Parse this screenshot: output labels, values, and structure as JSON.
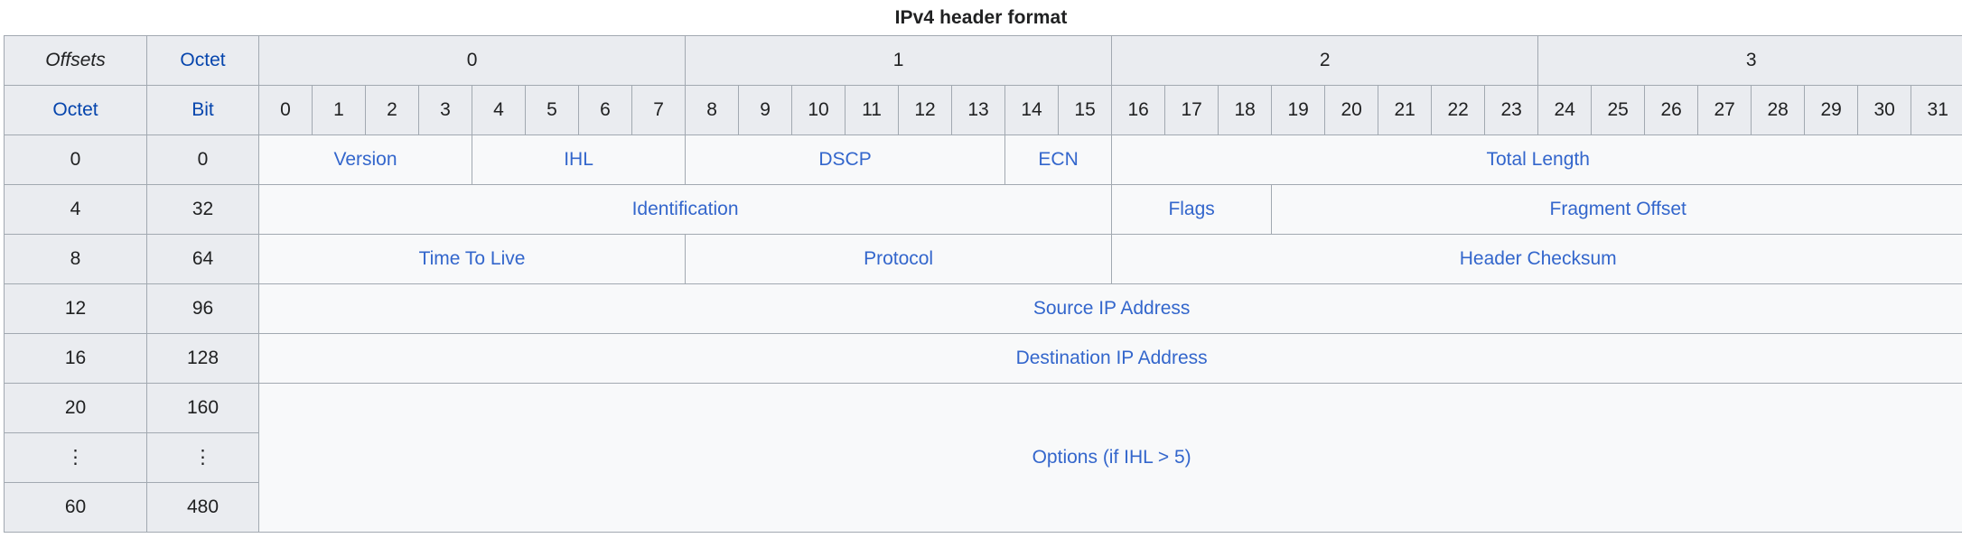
{
  "figure": {
    "title": "IPv4 header format"
  },
  "colors": {
    "link": "#3366cc",
    "header_bg": "#eaecf0",
    "cell_bg": "#f8f9fa",
    "border": "#a2a9b1",
    "text": "#202122",
    "header_link": "#0645ad"
  },
  "table": {
    "corner": {
      "offsets_label": "Offsets",
      "octet_label": "Octet",
      "octet_row_label": "Octet",
      "bit_label": "Bit"
    },
    "octet_groups": [
      "0",
      "1",
      "2",
      "3"
    ],
    "bits": [
      "0",
      "1",
      "2",
      "3",
      "4",
      "5",
      "6",
      "7",
      "8",
      "9",
      "10",
      "11",
      "12",
      "13",
      "14",
      "15",
      "16",
      "17",
      "18",
      "19",
      "20",
      "21",
      "22",
      "23",
      "24",
      "25",
      "26",
      "27",
      "28",
      "29",
      "30",
      "31"
    ],
    "rows": [
      {
        "octet_offset": "0",
        "bit_offset": "0",
        "fields": [
          {
            "label": "Version",
            "bits": 4
          },
          {
            "label": "IHL",
            "bits": 4
          },
          {
            "label": "DSCP",
            "bits": 6
          },
          {
            "label": "ECN",
            "bits": 2
          },
          {
            "label": "Total Length",
            "bits": 16
          }
        ]
      },
      {
        "octet_offset": "4",
        "bit_offset": "32",
        "fields": [
          {
            "label": "Identification",
            "bits": 16
          },
          {
            "label": "Flags",
            "bits": 3
          },
          {
            "label": "Fragment Offset",
            "bits": 13
          }
        ]
      },
      {
        "octet_offset": "8",
        "bit_offset": "64",
        "fields": [
          {
            "label": "Time To Live",
            "bits": 8
          },
          {
            "label": "Protocol",
            "bits": 8
          },
          {
            "label": "Header Checksum",
            "bits": 16
          }
        ]
      },
      {
        "octet_offset": "12",
        "bit_offset": "96",
        "fields": [
          {
            "label": "Source IP Address",
            "bits": 32
          }
        ]
      },
      {
        "octet_offset": "16",
        "bit_offset": "128",
        "fields": [
          {
            "label": "Destination IP Address",
            "bits": 32
          }
        ]
      },
      {
        "octet_offset": "20",
        "bit_offset": "160",
        "fields": []
      },
      {
        "octet_offset": "⋮",
        "bit_offset": "⋮",
        "fields": []
      },
      {
        "octet_offset": "60",
        "bit_offset": "480",
        "fields": []
      }
    ],
    "options": {
      "link_label": "Options",
      "condition": "(if IHL > 5)"
    }
  }
}
